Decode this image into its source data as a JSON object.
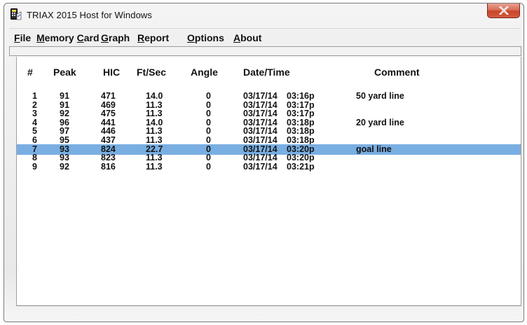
{
  "window": {
    "title": "TRIAX 2015 Host for Windows"
  },
  "menu": [
    {
      "label": "File"
    },
    {
      "label": "Memory Card"
    },
    {
      "label": "Graph"
    },
    {
      "label": "Report"
    },
    {
      "label": "Options"
    },
    {
      "label": "About"
    }
  ],
  "table": {
    "columns": [
      "#",
      "Peak",
      "HIC",
      "Ft/Sec",
      "Angle",
      "Date/Time",
      "Comment"
    ],
    "selected_row_index": 6,
    "rows": [
      {
        "num": "1",
        "peak": "91",
        "hic": "471",
        "ftsec": "14.0",
        "angle": "0",
        "date": "03/17/14",
        "time": "03:16p",
        "comment": "50 yard line"
      },
      {
        "num": "2",
        "peak": "91",
        "hic": "469",
        "ftsec": "11.3",
        "angle": "0",
        "date": "03/17/14",
        "time": "03:17p",
        "comment": ""
      },
      {
        "num": "3",
        "peak": "92",
        "hic": "475",
        "ftsec": "11.3",
        "angle": "0",
        "date": "03/17/14",
        "time": "03:17p",
        "comment": ""
      },
      {
        "num": "4",
        "peak": "96",
        "hic": "441",
        "ftsec": "14.0",
        "angle": "0",
        "date": "03/17/14",
        "time": "03:18p",
        "comment": "20 yard line"
      },
      {
        "num": "5",
        "peak": "97",
        "hic": "446",
        "ftsec": "11.3",
        "angle": "0",
        "date": "03/17/14",
        "time": "03:18p",
        "comment": ""
      },
      {
        "num": "6",
        "peak": "95",
        "hic": "437",
        "ftsec": "11.3",
        "angle": "0",
        "date": "03/17/14",
        "time": "03:18p",
        "comment": ""
      },
      {
        "num": "7",
        "peak": "93",
        "hic": "824",
        "ftsec": "22.7",
        "angle": "0",
        "date": "03/17/14",
        "time": "03:20p",
        "comment": "goal line"
      },
      {
        "num": "8",
        "peak": "93",
        "hic": "823",
        "ftsec": "11.3",
        "angle": "0",
        "date": "03/17/14",
        "time": "03:20p",
        "comment": ""
      },
      {
        "num": "9",
        "peak": "92",
        "hic": "816",
        "ftsec": "11.3",
        "angle": "0",
        "date": "03/17/14",
        "time": "03:21p",
        "comment": ""
      }
    ]
  },
  "colors": {
    "selection": "#79aee2",
    "close_button": "#c9452a"
  },
  "icons": {
    "app": "triax-device-icon",
    "close": "close-icon"
  }
}
